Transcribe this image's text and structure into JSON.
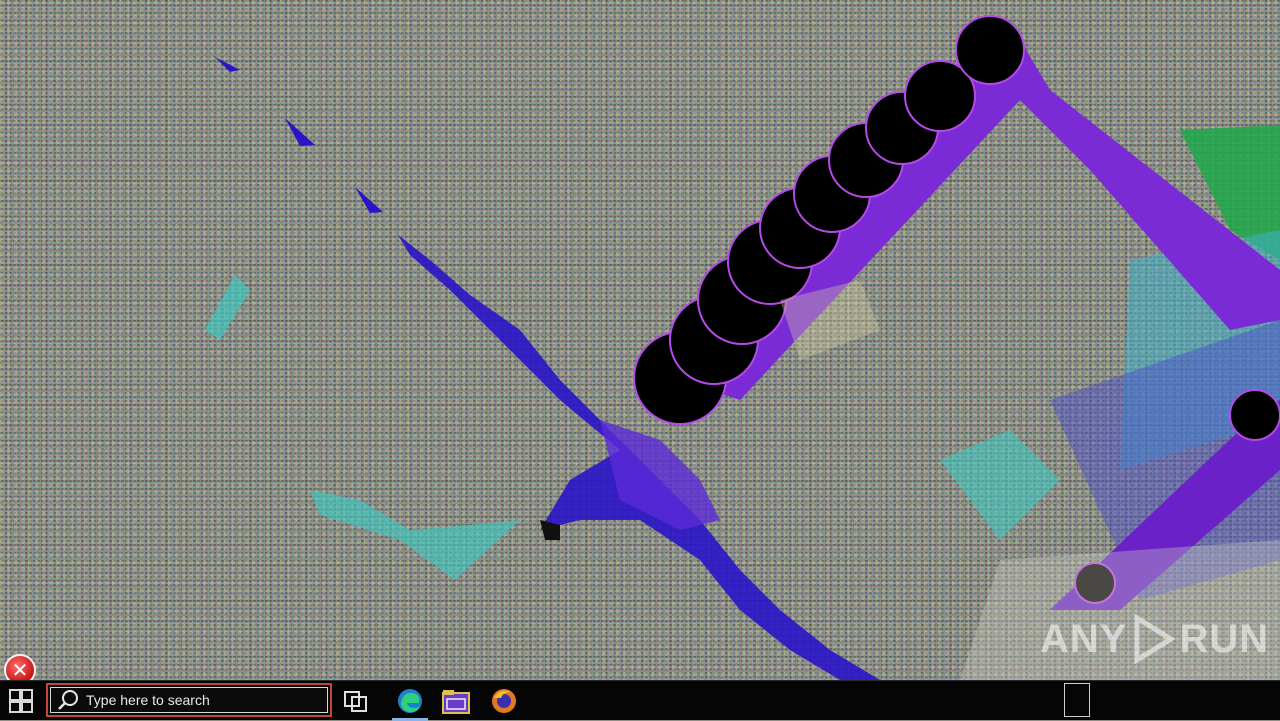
{
  "desktop": {
    "wallpaper_description_icon": "corrupted-noise-wallpaper",
    "error_icon": "error-x-icon",
    "error_glyph": "✕"
  },
  "watermark": {
    "text_left": "ANY",
    "text_right": "RUN",
    "icon": "play-triangle-icon"
  },
  "taskbar": {
    "start_icon": "windows-start-icon",
    "search": {
      "placeholder": "Type here to search",
      "icon": "search-icon"
    },
    "buttons": [
      {
        "name": "task-view-icon"
      },
      {
        "name": "edge-browser-icon",
        "active": true
      },
      {
        "name": "file-explorer-icon"
      },
      {
        "name": "firefox-icon"
      }
    ]
  },
  "colors": {
    "purple": "#7a2bd6",
    "blue": "#2a14c8",
    "cyan": "#3fc8c0",
    "green": "#1fa84a",
    "taskbar": "#050505",
    "search_border": "#c04a3a"
  }
}
